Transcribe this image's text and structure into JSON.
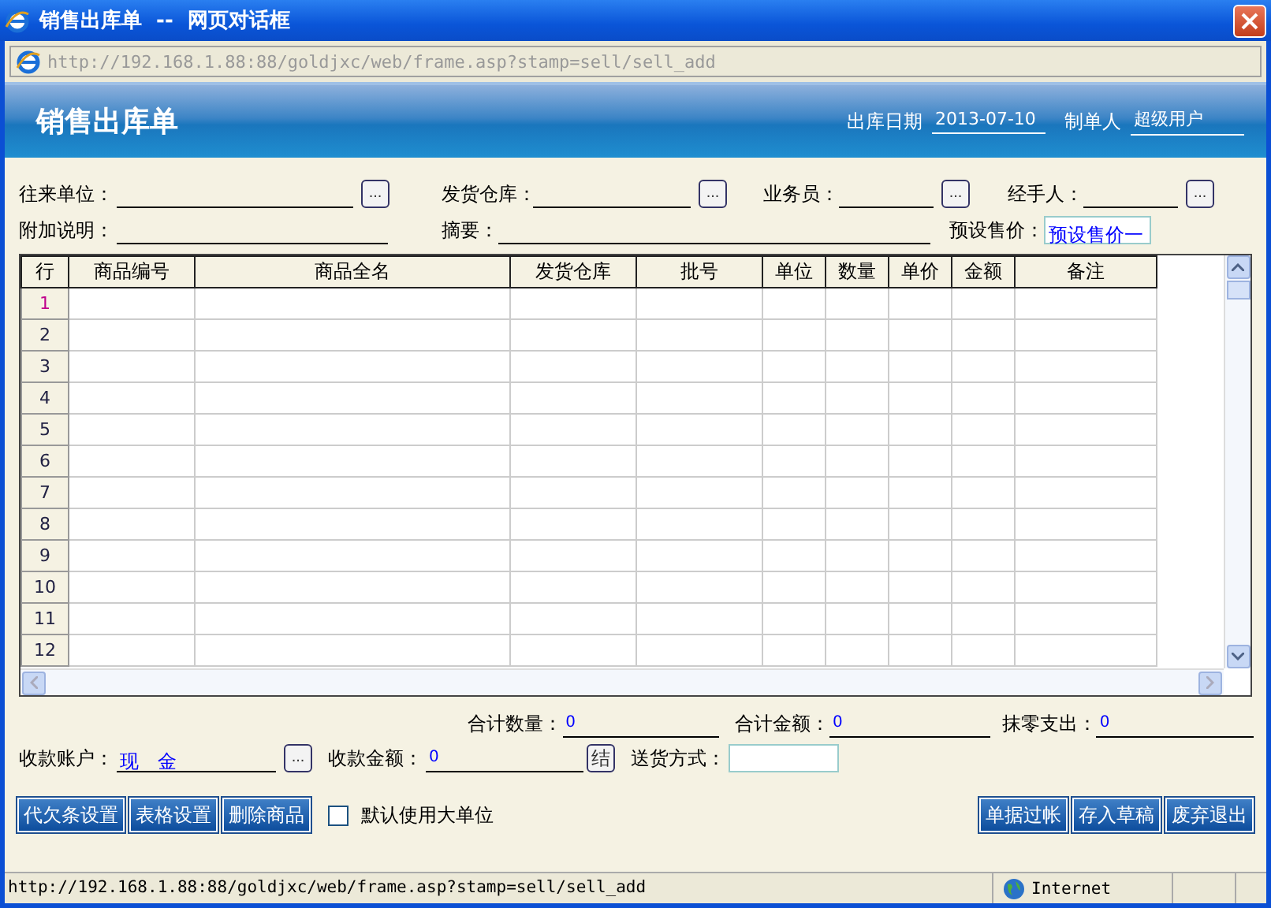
{
  "window": {
    "title": "销售出库单  --  网页对话框"
  },
  "address_bar": {
    "url": "http://192.168.1.88:88/goldjxc/web/frame.asp?stamp=sell/sell_add"
  },
  "header": {
    "title": "销售出库单",
    "date_label": "出库日期",
    "date": "2013-07-10",
    "maker_label": "制单人",
    "maker": "超级用户"
  },
  "form_rows": [
    [
      {
        "label": "往来单位：",
        "picker": "..."
      },
      {
        "label": "发货仓库：",
        "picker": "..."
      },
      {
        "label": "业务员：",
        "picker": "..."
      },
      {
        "label": "经手人：",
        "picker": "..."
      }
    ],
    [
      {
        "label": "附加说明："
      },
      {
        "label": "摘要："
      },
      {
        "label": "预设售价：",
        "value": "预设售价一"
      }
    ]
  ],
  "table": {
    "columns": [
      "行",
      "商品编号",
      "商品全名",
      "发货仓库",
      "批号",
      "单位",
      "数量",
      "单价",
      "金额",
      "备注"
    ],
    "rows": [
      {
        "number": "1",
        "selected": true
      },
      {
        "number": "2",
        "selected": false
      },
      {
        "number": "3",
        "selected": false
      },
      {
        "number": "4",
        "selected": false
      },
      {
        "number": "5",
        "selected": false
      },
      {
        "number": "6",
        "selected": false
      },
      {
        "number": "7",
        "selected": false
      },
      {
        "number": "8",
        "selected": false
      },
      {
        "number": "9",
        "selected": false
      },
      {
        "number": "10",
        "selected": false
      },
      {
        "number": "11",
        "selected": false
      },
      {
        "number": "12",
        "selected": false
      }
    ]
  },
  "totals": [
    {
      "label": "合计数量：",
      "value": "0"
    },
    {
      "label": "合计金额：",
      "value": "0"
    },
    {
      "label": "抹零支出：",
      "value": "0"
    }
  ],
  "payment": [
    {
      "label": "收款账户：",
      "value": "现　金",
      "picker": "..."
    },
    {
      "label": "收款金额：",
      "value": "0",
      "picker": "结"
    },
    {
      "label": "送货方式："
    }
  ],
  "left_buttons": [
    "代欠条设置",
    "表格设置",
    "删除商品"
  ],
  "default_unit_checkbox": {
    "label": "默认使用大单位",
    "checked": false
  },
  "right_buttons": [
    "单据过帐",
    "存入草稿",
    "废弃退出"
  ],
  "status_bar": {
    "url": "http://192.168.1.88:88/goldjxc/web/frame.asp?stamp=sell/sell_add",
    "zone": "Internet"
  }
}
